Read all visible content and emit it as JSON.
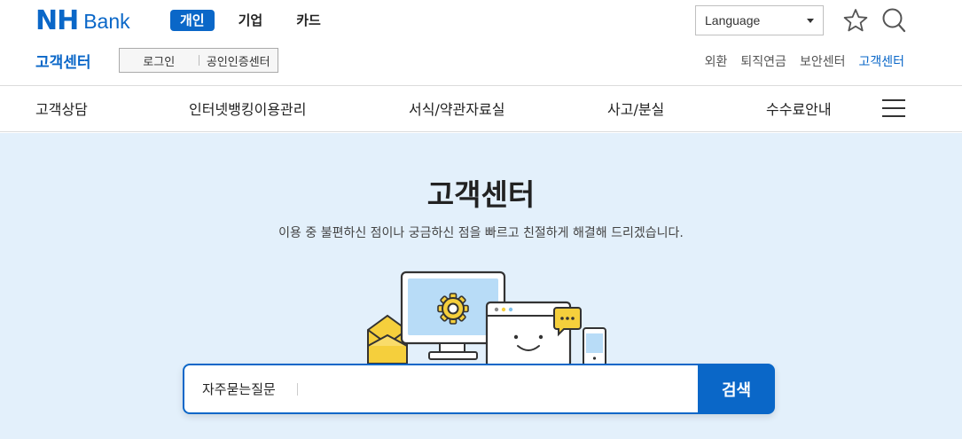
{
  "header": {
    "logo": {
      "nh": "NH",
      "bank": "Bank"
    },
    "main_tabs": [
      {
        "label": "개인",
        "active": true
      },
      {
        "label": "기업",
        "active": false
      },
      {
        "label": "카드",
        "active": false
      }
    ],
    "language_label": "Language",
    "section_title": "고객센터",
    "login": {
      "login_label": "로그인",
      "cert_label": "공인인증센터"
    },
    "util_links": [
      {
        "label": "외환",
        "active": false
      },
      {
        "label": "퇴직연금",
        "active": false
      },
      {
        "label": "보안센터",
        "active": false
      },
      {
        "label": "고객센터",
        "active": true
      }
    ]
  },
  "subnav": {
    "items": [
      "고객상담",
      "인터넷뱅킹이용관리",
      "서식/약관자료실",
      "사고/분실",
      "수수료안내"
    ]
  },
  "hero": {
    "title": "고객센터",
    "description": "이용 중 불편하신 점이나 궁금하신 점을 빠르고 친절하게 해결해 드리겠습니다.",
    "search": {
      "category": "자주묻는질문",
      "placeholder": "",
      "value": "",
      "submit_label": "검색"
    }
  },
  "colors": {
    "brand": "#0a67c8",
    "hero_bg": "#e3f0fb"
  },
  "icons": [
    "star-icon",
    "search-icon",
    "hamburger-menu-icon",
    "gear-icon",
    "envelope-icon",
    "chat-bubble-icon",
    "smartphone-icon"
  ]
}
